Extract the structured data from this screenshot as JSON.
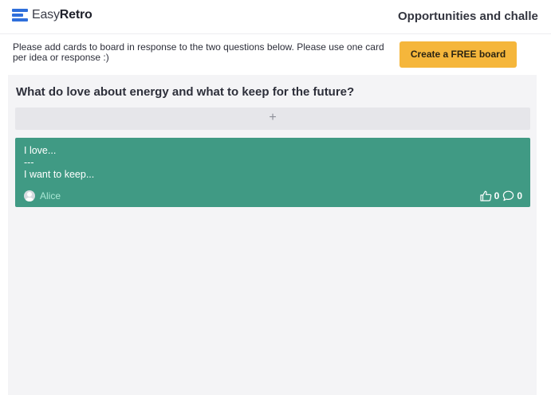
{
  "header": {
    "logo_easy": "Easy",
    "logo_retro": "Retro",
    "board_title": "Opportunities and challe"
  },
  "notice": {
    "text": "Please add cards to board in response to the two questions below. Please use one card per idea or response :)"
  },
  "cta": {
    "label": "Create a FREE board",
    "color": "#f5b63b"
  },
  "column": {
    "title": "What do love about energy and what to keep for the future?",
    "add_label": "+",
    "cards": [
      {
        "text": "I love...\n---\nI want to keep...",
        "author": "Alice",
        "likes": "0",
        "comments": "0",
        "color": "#409a84"
      }
    ]
  },
  "icons": {
    "logo": "easyretro-logo-icon",
    "avatar": "user-avatar-icon",
    "like": "thumbs-up-icon",
    "comment": "comment-bubble-icon"
  }
}
